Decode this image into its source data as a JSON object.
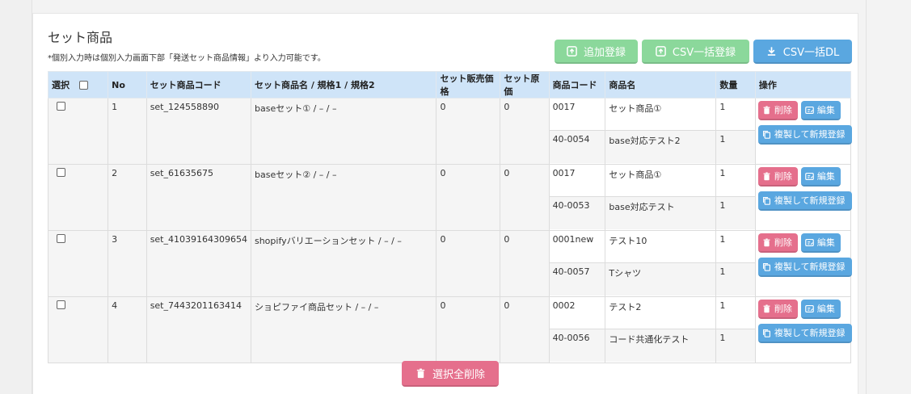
{
  "page": {
    "title": "セット商品",
    "note": "*個別入力時は個別入力画面下部「発送セット商品情報」より入力可能です。"
  },
  "toolbar": {
    "add_label": "追加登録",
    "csv_import_label": "CSV一括登録",
    "csv_download_label": "CSV一括DL"
  },
  "colors": {
    "header_bg": "#cfe4f8",
    "green_button": "#8bd89b",
    "blue_button": "#5aa7e0",
    "pink_button": "#e56f8c"
  },
  "table": {
    "headers": [
      "選択",
      "No",
      "セット商品コード",
      "セット商品名 / 規格1 / 規格2",
      "セット販売価格",
      "セット原価",
      "商品コード",
      "商品名",
      "数量",
      "操作"
    ],
    "rows": [
      {
        "no": "1",
        "set_code": "set_124558890",
        "set_name": "baseセット① / – / –",
        "price": "0",
        "cost": "0",
        "items": [
          {
            "code": "0017",
            "name": "セット商品①",
            "qty": "1"
          },
          {
            "code": "40-0054",
            "name": "base対応テスト2",
            "qty": "1"
          }
        ]
      },
      {
        "no": "2",
        "set_code": "set_61635675",
        "set_name": "baseセット② / – / –",
        "price": "0",
        "cost": "0",
        "items": [
          {
            "code": "0017",
            "name": "セット商品①",
            "qty": "1"
          },
          {
            "code": "40-0053",
            "name": "base対応テスト",
            "qty": "1"
          }
        ]
      },
      {
        "no": "3",
        "set_code": "set_41039164309654",
        "set_name": "shopifyバリエーションセット / – / –",
        "price": "0",
        "cost": "0",
        "items": [
          {
            "code": "0001new",
            "name": "テスト10",
            "qty": "1"
          },
          {
            "code": "40-0057",
            "name": "Tシャツ",
            "qty": "1"
          }
        ]
      },
      {
        "no": "4",
        "set_code": "set_7443201163414",
        "set_name": "ショピファイ商品セット / – / –",
        "price": "0",
        "cost": "0",
        "items": [
          {
            "code": "0002",
            "name": "テスト2",
            "qty": "1"
          },
          {
            "code": "40-0056",
            "name": "コード共通化テスト",
            "qty": "1"
          }
        ]
      }
    ],
    "row_actions": {
      "delete_label": "削除",
      "edit_label": "編集",
      "duplicate_label": "複製して新規登録"
    }
  },
  "footer": {
    "bulk_delete_label": "選択全削除"
  },
  "icons": {
    "upload": "upload-icon",
    "download": "download-icon",
    "trash": "trash-icon",
    "edit": "edit-icon",
    "copy": "copy-icon"
  }
}
